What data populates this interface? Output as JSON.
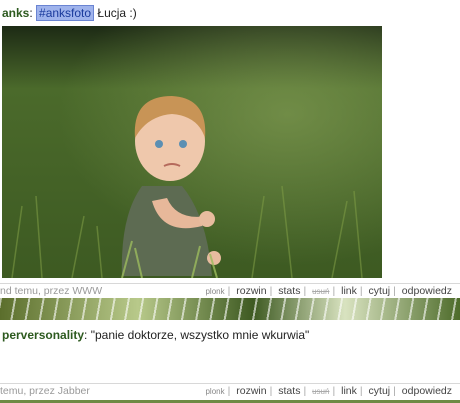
{
  "posts": [
    {
      "author": "anks",
      "tag": "#anksfoto",
      "text": " Łucja :)",
      "meta": "nd temu, przez WWW",
      "actions": [
        "plonk",
        "rozwin",
        "stats",
        "usuń",
        "link",
        "cytuj",
        "odpowiedz"
      ]
    },
    {
      "author": "perversonality",
      "text": ": \"panie doktorze, wszystko mnie wkurwia\"",
      "meta": "temu, przez Jabber",
      "actions": [
        "plonk",
        "rozwin",
        "stats",
        "usuń",
        "link",
        "cytuj",
        "odpowiedz"
      ]
    }
  ],
  "colors": {
    "author": "#2d5a1f",
    "tag_bg": "#9fb3ec",
    "background_grass": "#6e8a44"
  },
  "icons": {
    "photo": "child-in-grass-photo"
  }
}
